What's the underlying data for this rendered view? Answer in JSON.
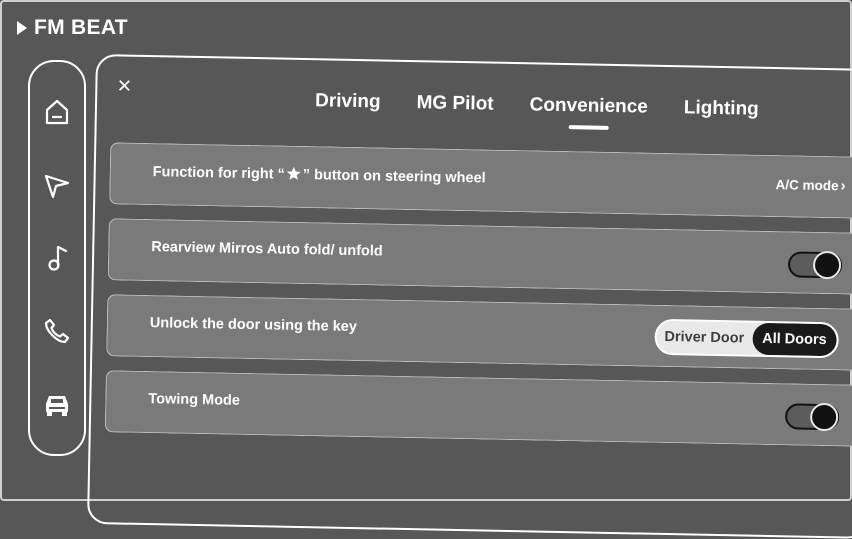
{
  "status_bar": {
    "source_label": "FM BEAT"
  },
  "sidebar": {
    "items": [
      {
        "icon": "home-icon"
      },
      {
        "icon": "navigation-icon"
      },
      {
        "icon": "music-note-icon"
      },
      {
        "icon": "phone-icon"
      },
      {
        "icon": "car-icon"
      }
    ]
  },
  "settings": {
    "close_label": "×",
    "tabs": [
      {
        "label": "Driving"
      },
      {
        "label": "MG Pilot"
      },
      {
        "label": "Convenience",
        "active": true
      },
      {
        "label": "Lighting"
      }
    ],
    "rows": [
      {
        "label_prefix": "Function for right “",
        "label_icon": "star-icon",
        "label_suffix": "” button on steering wheel",
        "value": "A/C mode",
        "value_icon": "chevron-right-icon"
      },
      {
        "label": "Rearview Mirros Auto fold/ unfold",
        "toggle_on": true
      },
      {
        "label": "Unlock the door using the key",
        "options": [
          "Driver Door",
          "All Doors"
        ],
        "selected": "All Doors"
      },
      {
        "label": "Towing Mode",
        "toggle_on": true
      }
    ]
  },
  "colors": {
    "background": "#575757",
    "row_fill": "#7a7a7a",
    "toggle_knob": "#111111",
    "segment_bg": "#e9e9e9"
  }
}
